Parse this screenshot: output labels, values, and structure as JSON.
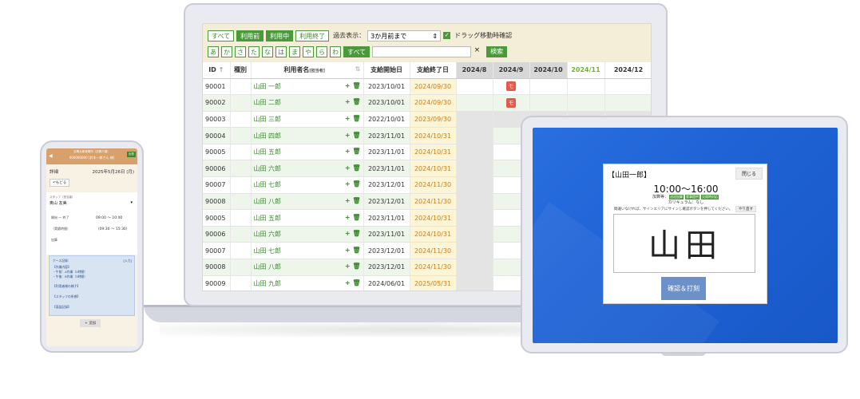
{
  "laptop": {
    "filters": {
      "status_buttons": [
        "すべて",
        "利用前",
        "利用中",
        "利用終了"
      ],
      "past_display_label": "過去表示：",
      "past_display_value": "3か月前まで",
      "drag_confirm_label": "ドラッグ移動時確認",
      "kana_buttons": [
        "あ",
        "か",
        "さ",
        "た",
        "な",
        "は",
        "ま",
        "や",
        "ら",
        "わ"
      ],
      "kana_all": "すべて",
      "search_value": "",
      "clear_label": "×",
      "search_button": "検索"
    },
    "table": {
      "headers": {
        "id": "ID",
        "id_sort": "↑",
        "type": "種別",
        "name": "利用者名",
        "name_sub": "[担当者]",
        "start": "支給開始日",
        "end": "支給終了日",
        "months": [
          "2024/8",
          "2024/9",
          "2024/10",
          "2024/11",
          "2024/12"
        ]
      },
      "rows": [
        {
          "id": "90001",
          "name": "山田 一郎",
          "start": "2023/10/01",
          "end": "2024/09/30",
          "mark": "モ"
        },
        {
          "id": "90002",
          "name": "山田 二郎",
          "start": "2023/10/01",
          "end": "2024/09/30",
          "mark": "モ"
        },
        {
          "id": "90003",
          "name": "山田 三郎",
          "start": "2022/10/01",
          "end": "2023/09/30",
          "mark": ""
        },
        {
          "id": "90004",
          "name": "山田 四郎",
          "start": "2023/11/01",
          "end": "2024/10/31",
          "mark": ""
        },
        {
          "id": "90005",
          "name": "山田 五郎",
          "start": "2023/11/01",
          "end": "2024/10/31",
          "mark": ""
        },
        {
          "id": "90006",
          "name": "山田 六郎",
          "start": "2023/11/01",
          "end": "2024/10/31",
          "mark": ""
        },
        {
          "id": "90007",
          "name": "山田 七郎",
          "start": "2023/12/01",
          "end": "2024/11/30",
          "mark": ""
        },
        {
          "id": "90008",
          "name": "山田 八郎",
          "start": "2023/12/01",
          "end": "2024/11/30",
          "mark": ""
        },
        {
          "id": "90005",
          "name": "山田 五郎",
          "start": "2023/11/01",
          "end": "2024/10/31",
          "mark": ""
        },
        {
          "id": "90006",
          "name": "山田 六郎",
          "start": "2023/11/01",
          "end": "2024/10/31",
          "mark": ""
        },
        {
          "id": "90007",
          "name": "山田 七郎",
          "start": "2023/12/01",
          "end": "2024/11/30",
          "mark": ""
        },
        {
          "id": "90008",
          "name": "山田 八郎",
          "start": "2023/12/01",
          "end": "2024/11/30",
          "mark": ""
        },
        {
          "id": "90009",
          "name": "山田 九郎",
          "start": "2024/06/01",
          "end": "2025/05/31",
          "mark": ""
        }
      ],
      "row_actions": {
        "add": "+",
        "delete": "🗑"
      }
    }
  },
  "tablet": {
    "title": "【山田一郎】",
    "close": "閉じる",
    "time": "10:00〜16:00",
    "addition_label": "加算等：",
    "addition_tags": [
      "送迎加算",
      "食事提供",
      "欠席時対応"
    ],
    "curriculum": "カリキュラム：なし",
    "note": "間違いなければ、サインエリアにサインし確認ボタンを押してください。",
    "redo": "やり直す",
    "signature": "山田",
    "confirm": "確認＆打刻"
  },
  "phone": {
    "header_line1": "訪問太郎事業所（訪問介護）",
    "header_line2": "000000000 [鈴木一郎さん 様]",
    "checkin": "出勤",
    "page_title": "詳細",
    "date": "2025年5月26日 (月)",
    "back_button": "もどる",
    "staff_label": "スタッフ（担当者）",
    "staff_name": "奥山 友美",
    "rows": [
      {
        "label": "開始 〜 終了",
        "value": "09:00 〜 10:00"
      },
      {
        "label": "（実績時間）",
        "value": "（09:30 〜 15:30）"
      },
      {
        "label": "加算",
        "value": ""
      }
    ],
    "notes_title": "ケース記録：",
    "notes_tag": "[入力]",
    "notes": [
      "【作業内容】",
      "・午前：A作業（2時間）",
      "・午後：B作業（3時間）",
      "【利用者様の様子】",
      "【スタッフの所感】",
      "【面談記録】"
    ],
    "add_button": "+ 追加"
  }
}
